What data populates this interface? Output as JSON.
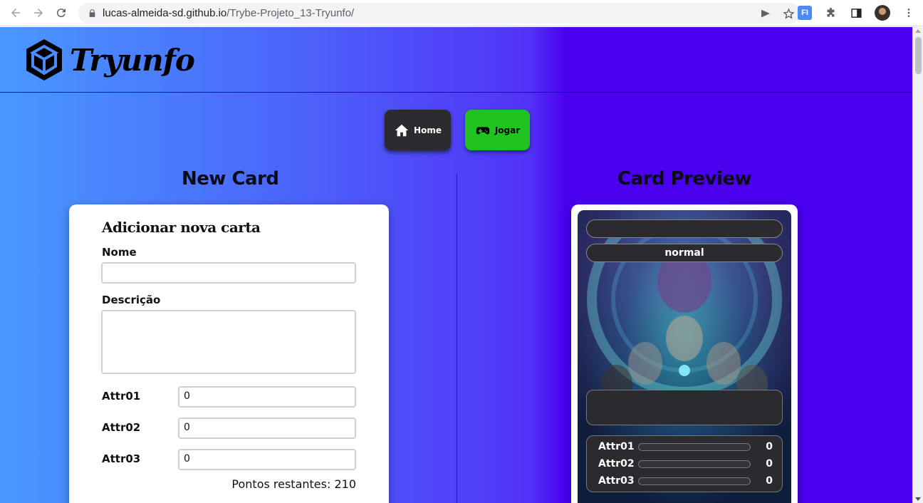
{
  "browser": {
    "url_host": "lucas-almeida-sd.github.io",
    "url_path": "/Trybe-Projeto_13-Tryunfo/",
    "extension_badge": "FI"
  },
  "header": {
    "brand": "Tryunfo"
  },
  "nav": {
    "home_label": "Home",
    "play_label": "Jogar"
  },
  "form": {
    "section_title": "New Card",
    "heading": "Adicionar nova carta",
    "name_label": "Nome",
    "name_value": "",
    "description_label": "Descrição",
    "description_value": "",
    "attrs": [
      {
        "label": "Attr01",
        "value": "0"
      },
      {
        "label": "Attr02",
        "value": "0"
      },
      {
        "label": "Attr03",
        "value": "0"
      }
    ],
    "remaining_points": "Pontos restantes: 210"
  },
  "preview": {
    "section_title": "Card Preview",
    "card_name": "",
    "rarity": "normal",
    "description": "",
    "attrs": [
      {
        "label": "Attr01",
        "value": "0"
      },
      {
        "label": "Attr02",
        "value": "0"
      },
      {
        "label": "Attr03",
        "value": "0"
      }
    ]
  },
  "colors": {
    "home_button": "#2b2b2f",
    "play_button": "#1fc21f",
    "bg_left": "#4a98ff",
    "bg_right": "#4a00ee"
  }
}
